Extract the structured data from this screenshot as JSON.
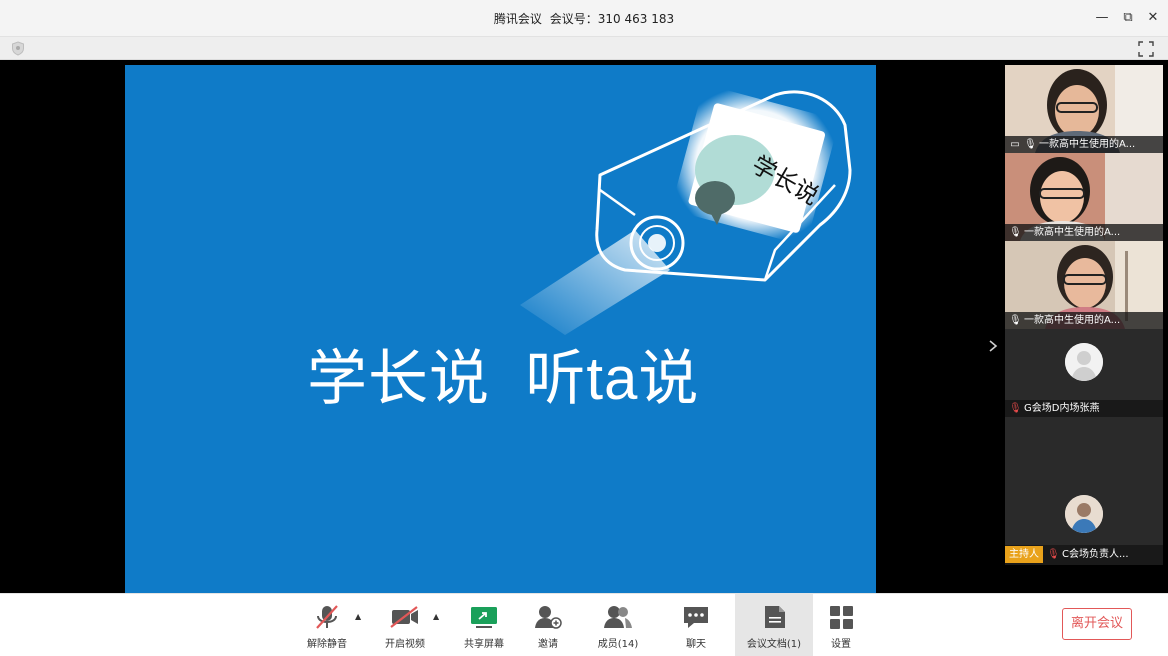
{
  "window": {
    "app_name": "腾讯会议",
    "meeting_id_label": "会议号：",
    "meeting_id": "310 463 183",
    "min_glyph": "—",
    "restore_glyph": "⧉",
    "close_glyph": "✕"
  },
  "slide": {
    "title": "学长说  听ta说",
    "badge_text": "学长说",
    "bg_color": "#0f7bc8"
  },
  "participants": [
    {
      "name": "一款高中生使用的A...",
      "video": true,
      "mic": "on",
      "sharing": true
    },
    {
      "name": "一款高中生使用的A...",
      "video": true,
      "mic": "on"
    },
    {
      "name": "一款高中生使用的A...",
      "video": true,
      "mic": "on"
    },
    {
      "name": "G会场D内场张燕",
      "video": false,
      "mic": "muted"
    },
    {
      "name": "C会场负责人...",
      "video": false,
      "mic": "muted",
      "host_label": "主持人"
    }
  ],
  "toolbar": {
    "unmute": "解除静音",
    "start_video": "开启视频",
    "share_screen": "共享屏幕",
    "invite": "邀请",
    "members": "成员(14)",
    "chat": "聊天",
    "docs": "会议文档(1)",
    "settings": "设置",
    "leave": "离开会议"
  },
  "colors": {
    "accent_red": "#e25858",
    "host_badge": "#e9a21b",
    "share_green": "#1aa05a"
  }
}
